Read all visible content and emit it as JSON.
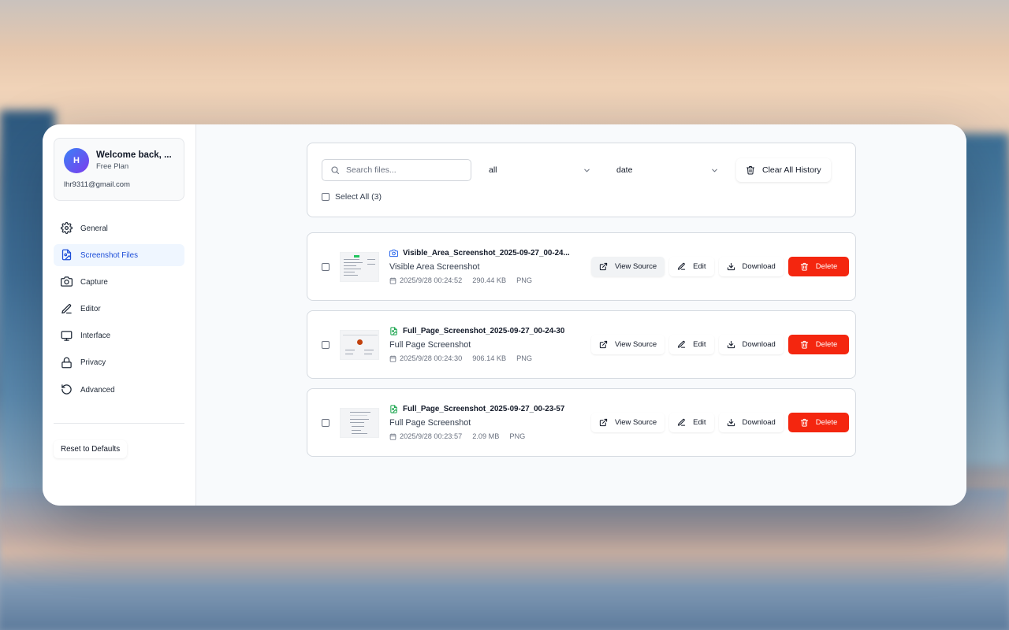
{
  "user": {
    "avatar_initial": "H",
    "welcome": "Welcome back, ...",
    "plan": "Free Plan",
    "email": "lhr9311@gmail.com"
  },
  "nav": [
    {
      "label": "General",
      "icon": "gear-icon",
      "active": false
    },
    {
      "label": "Screenshot Files",
      "icon": "image-file-icon",
      "active": true
    },
    {
      "label": "Capture",
      "icon": "camera-icon",
      "active": false
    },
    {
      "label": "Editor",
      "icon": "pen-icon",
      "active": false
    },
    {
      "label": "Interface",
      "icon": "monitor-icon",
      "active": false
    },
    {
      "label": "Privacy",
      "icon": "lock-icon",
      "active": false
    },
    {
      "label": "Advanced",
      "icon": "rotate-icon",
      "active": false
    }
  ],
  "reset_label": "Reset to Defaults",
  "toolbar": {
    "search_placeholder": "Search files...",
    "type_filter": "all",
    "sort_by": "date",
    "clear_label": "Clear All History",
    "select_all_label": "Select All (3)"
  },
  "actions": {
    "view_source": "View Source",
    "edit": "Edit",
    "download": "Download",
    "delete": "Delete"
  },
  "files": [
    {
      "name": "Visible_Area_Screenshot_2025-09-27_00-24...",
      "kind": "Visible Area Screenshot",
      "date": "2025/9/28 00:24:52",
      "size": "290.44 KB",
      "format": "PNG",
      "icon": "camera-icon"
    },
    {
      "name": "Full_Page_Screenshot_2025-09-27_00-24-30",
      "kind": "Full Page Screenshot",
      "date": "2025/9/28 00:24:30",
      "size": "906.14 KB",
      "format": "PNG",
      "icon": "image-file-icon"
    },
    {
      "name": "Full_Page_Screenshot_2025-09-27_00-23-57",
      "kind": "Full Page Screenshot",
      "date": "2025/9/28 00:23:57",
      "size": "2.09 MB",
      "format": "PNG",
      "icon": "image-file-icon"
    }
  ],
  "colors": {
    "accent": "#1d4ed8",
    "active_bg": "#eff6ff",
    "danger": "#f4260f",
    "camera_icon": "#2563eb",
    "file_icon": "#16a34a"
  }
}
